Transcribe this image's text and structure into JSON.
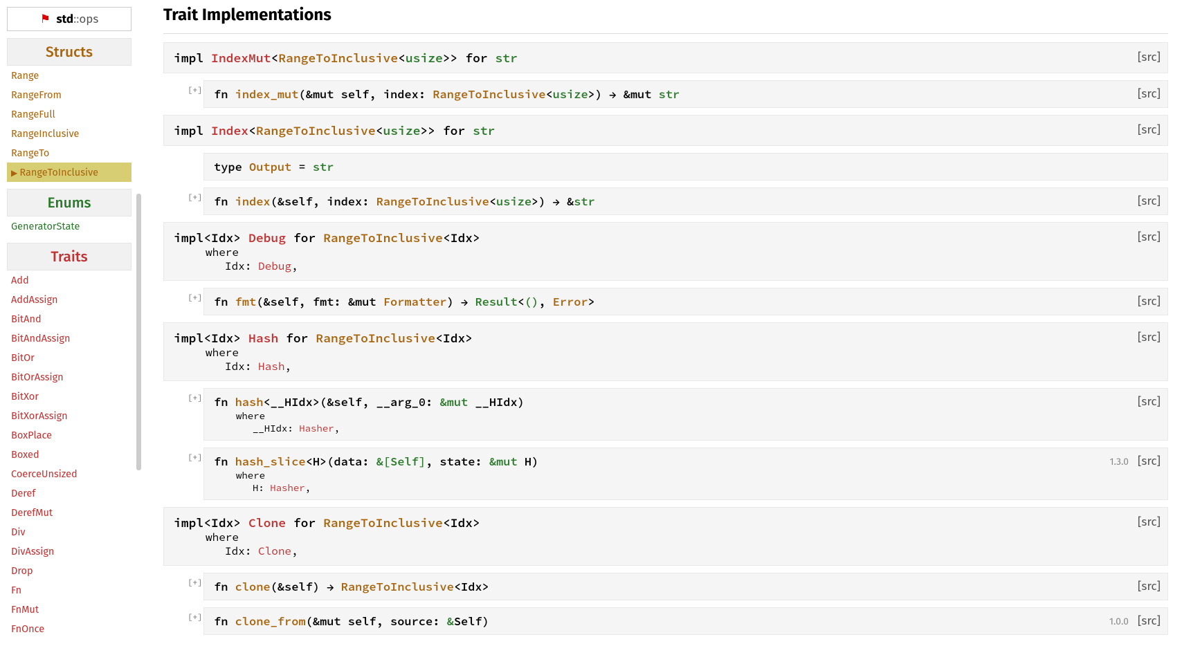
{
  "location": {
    "flag": "⚑",
    "ns1": "std",
    "sep": "::",
    "ns2": "ops"
  },
  "sidebar": {
    "structs_title": "Structs",
    "structs": [
      "Range",
      "RangeFrom",
      "RangeFull",
      "RangeInclusive",
      "RangeTo",
      "RangeToInclusive"
    ],
    "structs_current": 5,
    "enums_title": "Enums",
    "enums": [
      "GeneratorState"
    ],
    "traits_title": "Traits",
    "traits": [
      "Add",
      "AddAssign",
      "BitAnd",
      "BitAndAssign",
      "BitOr",
      "BitOrAssign",
      "BitXor",
      "BitXorAssign",
      "BoxPlace",
      "Boxed",
      "CoerceUnsized",
      "Deref",
      "DerefMut",
      "Div",
      "DivAssign",
      "Drop",
      "Fn",
      "FnMut",
      "FnOnce"
    ]
  },
  "main": {
    "section_title": "Trait Implementations",
    "src": "[src]",
    "expand": "[+]",
    "impl_kw": "impl",
    "for_kw": "for",
    "fn_kw": "fn",
    "type_kw": "type",
    "where_kw": "where",
    "arrow": "→",
    "sig": {
      "IndexMut": "IndexMut",
      "Index": "Index",
      "Debug": "Debug",
      "Hash": "Hash",
      "Clone": "Clone",
      "RangeToInclusive": "RangeToInclusive",
      "usize": "usize",
      "str": "str",
      "Output": "Output",
      "Formatter": "Formatter",
      "Result": "Result",
      "Error": "Error",
      "Hasher": "Hasher",
      "Self": "Self",
      "index_mut": "index_mut",
      "index": "index",
      "fmt": "fmt",
      "hash": "hash",
      "hash_slice": "hash_slice",
      "clone": "clone",
      "clone_from": "clone_from",
      "Idx": "Idx",
      "HIdx": "__HIdx",
      "H": "H",
      "arg0": "__arg_0",
      "since130": "1.3.0",
      "since100": "1.0.0"
    }
  }
}
